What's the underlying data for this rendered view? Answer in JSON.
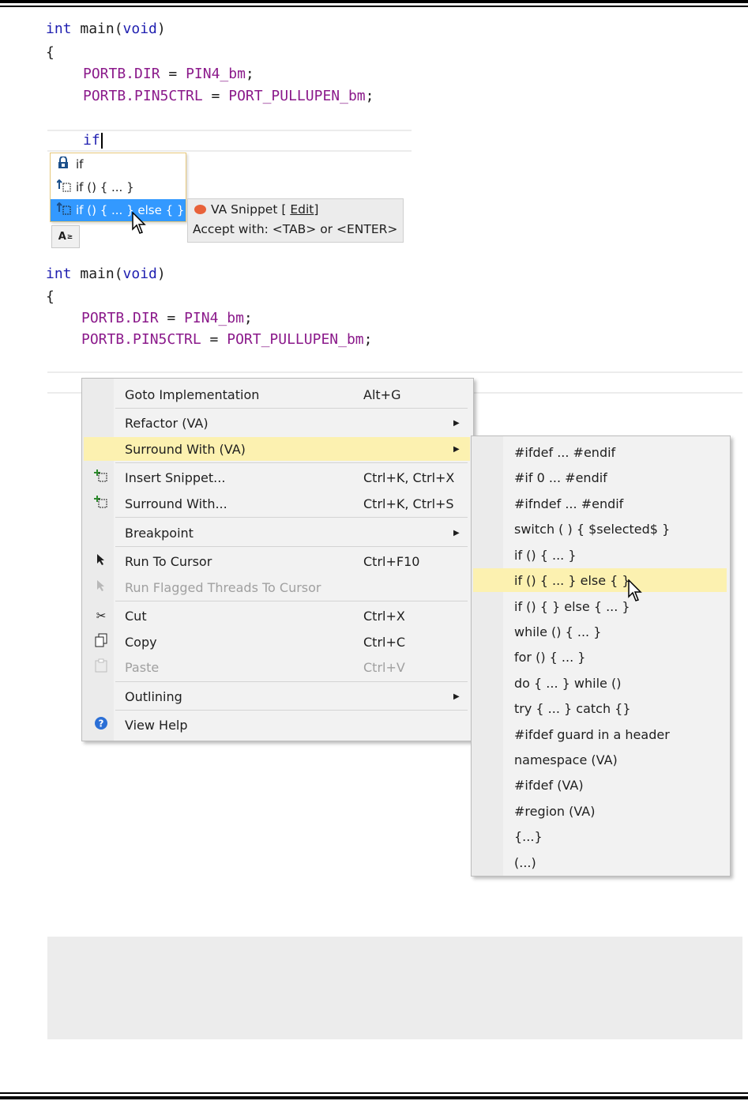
{
  "code_top": {
    "line1": {
      "kw1": "int",
      "fn": " main(",
      "kw2": "void",
      ")": ")"
    },
    "open_brace": "{",
    "line3": {
      "a": "PORTB.DIR",
      "eq": " = ",
      "b": "PIN4_bm",
      ";": ";"
    },
    "line4": {
      "a": "PORTB.PIN5CTRL",
      "eq": " = ",
      "b": "PORT_PULLUPEN_bm",
      ";": ";"
    },
    "typed": "if"
  },
  "autocomplete": {
    "items": [
      {
        "label": "if",
        "icon": "snippet-lock-icon"
      },
      {
        "label": "if () { ... }",
        "icon": "va-snippet-icon"
      },
      {
        "label": "if () { ... } else { }",
        "icon": "va-snippet-icon"
      }
    ],
    "tooltip_title": "VA Snippet [",
    "tooltip_edit": "Edit",
    "tooltip_close": "]",
    "tooltip_hint": "Accept with: <TAB> or <ENTER>",
    "footer_label": "A"
  },
  "code_bottom": {
    "line1": {
      "kw1": "int",
      "fn": " main(",
      "kw2": "void",
      ")": ")"
    },
    "open_brace": "{",
    "line3": {
      "a": "PORTB.DIR",
      "eq": " = ",
      "b": "PIN4_bm",
      ";": ";"
    },
    "line4": {
      "a": "PORTB.PIN5CTRL",
      "eq": " = ",
      "b": "PORT_PULLUPEN_bm",
      ";": ";"
    }
  },
  "context_menu": {
    "items": [
      {
        "label": "Goto Implementation",
        "shortcut": "Alt+G"
      },
      {
        "label": "Refactor (VA)",
        "shortcut": ""
      },
      {
        "label": "Surround With (VA)",
        "shortcut": ""
      },
      {
        "label": "Insert Snippet...",
        "shortcut": "Ctrl+K, Ctrl+X"
      },
      {
        "label": "Surround With...",
        "shortcut": "Ctrl+K, Ctrl+S"
      },
      {
        "label": "Breakpoint",
        "shortcut": ""
      },
      {
        "label": "Run To Cursor",
        "shortcut": "Ctrl+F10"
      },
      {
        "label": "Run Flagged Threads To Cursor",
        "shortcut": ""
      },
      {
        "label": "Cut",
        "shortcut": "Ctrl+X"
      },
      {
        "label": "Copy",
        "shortcut": "Ctrl+C"
      },
      {
        "label": "Paste",
        "shortcut": "Ctrl+V"
      },
      {
        "label": "Outlining",
        "shortcut": ""
      },
      {
        "label": "View Help",
        "shortcut": ""
      }
    ],
    "arrow": "▶"
  },
  "submenu": {
    "items": [
      "#ifdef ... #endif",
      "#if 0 ... #endif",
      "#ifndef ... #endif",
      "switch ( ) { $selected$ }",
      "if () { ... }",
      "if () { ... } else { }",
      "if () { } else { ... }",
      "while () { ... }",
      "for () { ... }",
      "do { ... } while ()",
      "try { ... } catch {}",
      "#ifdef guard in a header",
      "namespace (VA)",
      "#ifdef (VA)",
      "#region (VA)",
      "{...}",
      "(...)"
    ]
  },
  "colors": {
    "highlight": "#fcf1b0",
    "selection": "#3399ff",
    "keyword": "#1f1fb0",
    "macro": "#8b1a8b"
  }
}
